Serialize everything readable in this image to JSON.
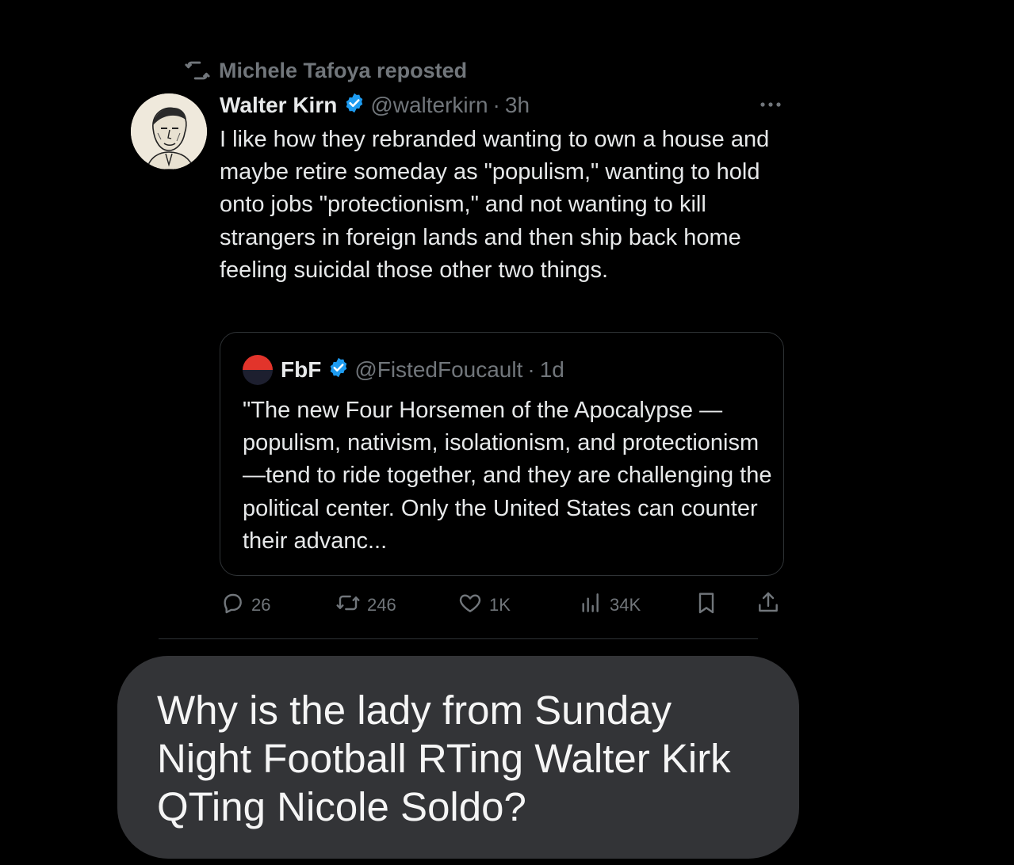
{
  "repost": {
    "icon": "repost-icon",
    "text": "Michele Tafoya reposted"
  },
  "tweet": {
    "author_name": "Walter Kirn",
    "handle": "@walterkirn",
    "separator": "·",
    "time": "3h",
    "more_icon": "more-icon",
    "text": "I like how they rebranded wanting to own a house and maybe retire someday as \"populism,\" wanting to hold onto jobs \"protectionism,\" and not wanting to kill strangers in foreign lands and then ship back home feeling suicidal those other two things."
  },
  "quote": {
    "author_name": "FbF",
    "handle": "@FistedFoucault",
    "separator": "·",
    "time": "1d",
    "text": "\"The new Four Horsemen of the Apocalypse —populism, nativism,  isolationism, and protectionism—tend to ride together, and they are  challenging the political center. Only the United States can counter  their advanc..."
  },
  "actions": {
    "replies": "26",
    "reposts": "246",
    "likes": "1K",
    "views": "34K"
  },
  "message": {
    "text": "Why is the lady from Sunday Night Football RTing Walter Kirk QTing Nicole Soldo?"
  },
  "colors": {
    "background": "#000000",
    "text": "#e7e9ea",
    "muted": "#71767b",
    "verified": "#1d9bf0",
    "border": "#2f3336",
    "bubble": "#333437"
  }
}
